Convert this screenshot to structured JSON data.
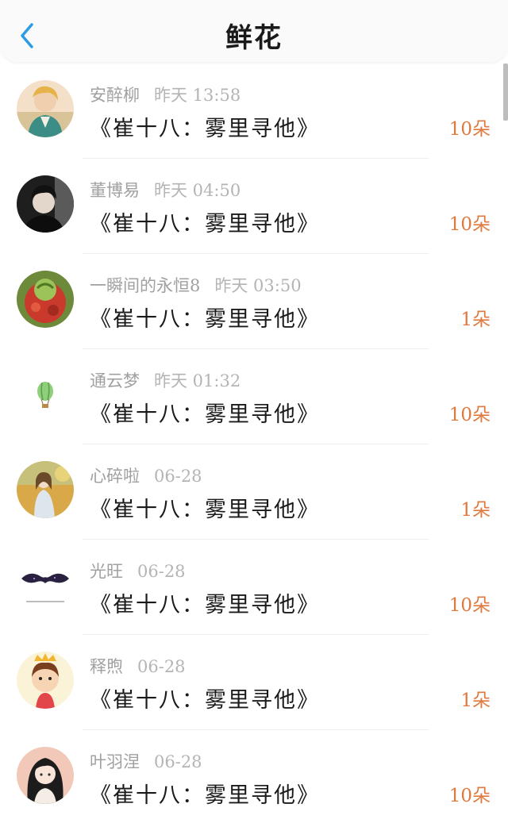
{
  "header": {
    "title": "鲜花",
    "back_icon": "chevron-left-icon",
    "accent": "#2d9ce5"
  },
  "theme": {
    "count_color": "#e07a3c"
  },
  "items": [
    {
      "name": "安醉柳",
      "time": "昨天 13:58",
      "book": "《崔十八：雾里寻他》",
      "count": "10朵"
    },
    {
      "name": "董博易",
      "time": "昨天 04:50",
      "book": "《崔十八：雾里寻他》",
      "count": "10朵"
    },
    {
      "name": "一瞬间的永恒8",
      "time": "昨天 03:50",
      "book": "《崔十八：雾里寻他》",
      "count": "1朵"
    },
    {
      "name": "通云梦",
      "time": "昨天 01:32",
      "book": "《崔十八：雾里寻他》",
      "count": "10朵"
    },
    {
      "name": "心碎啦",
      "time": "06-28",
      "book": "《崔十八：雾里寻他》",
      "count": "1朵"
    },
    {
      "name": "光旺",
      "time": "06-28",
      "book": "《崔十八：雾里寻他》",
      "count": "10朵"
    },
    {
      "name": "释煦",
      "time": "06-28",
      "book": "《崔十八：雾里寻他》",
      "count": "1朵"
    },
    {
      "name": "叶羽涅",
      "time": "06-28",
      "book": "《崔十八：雾里寻他》",
      "count": "10朵"
    }
  ]
}
